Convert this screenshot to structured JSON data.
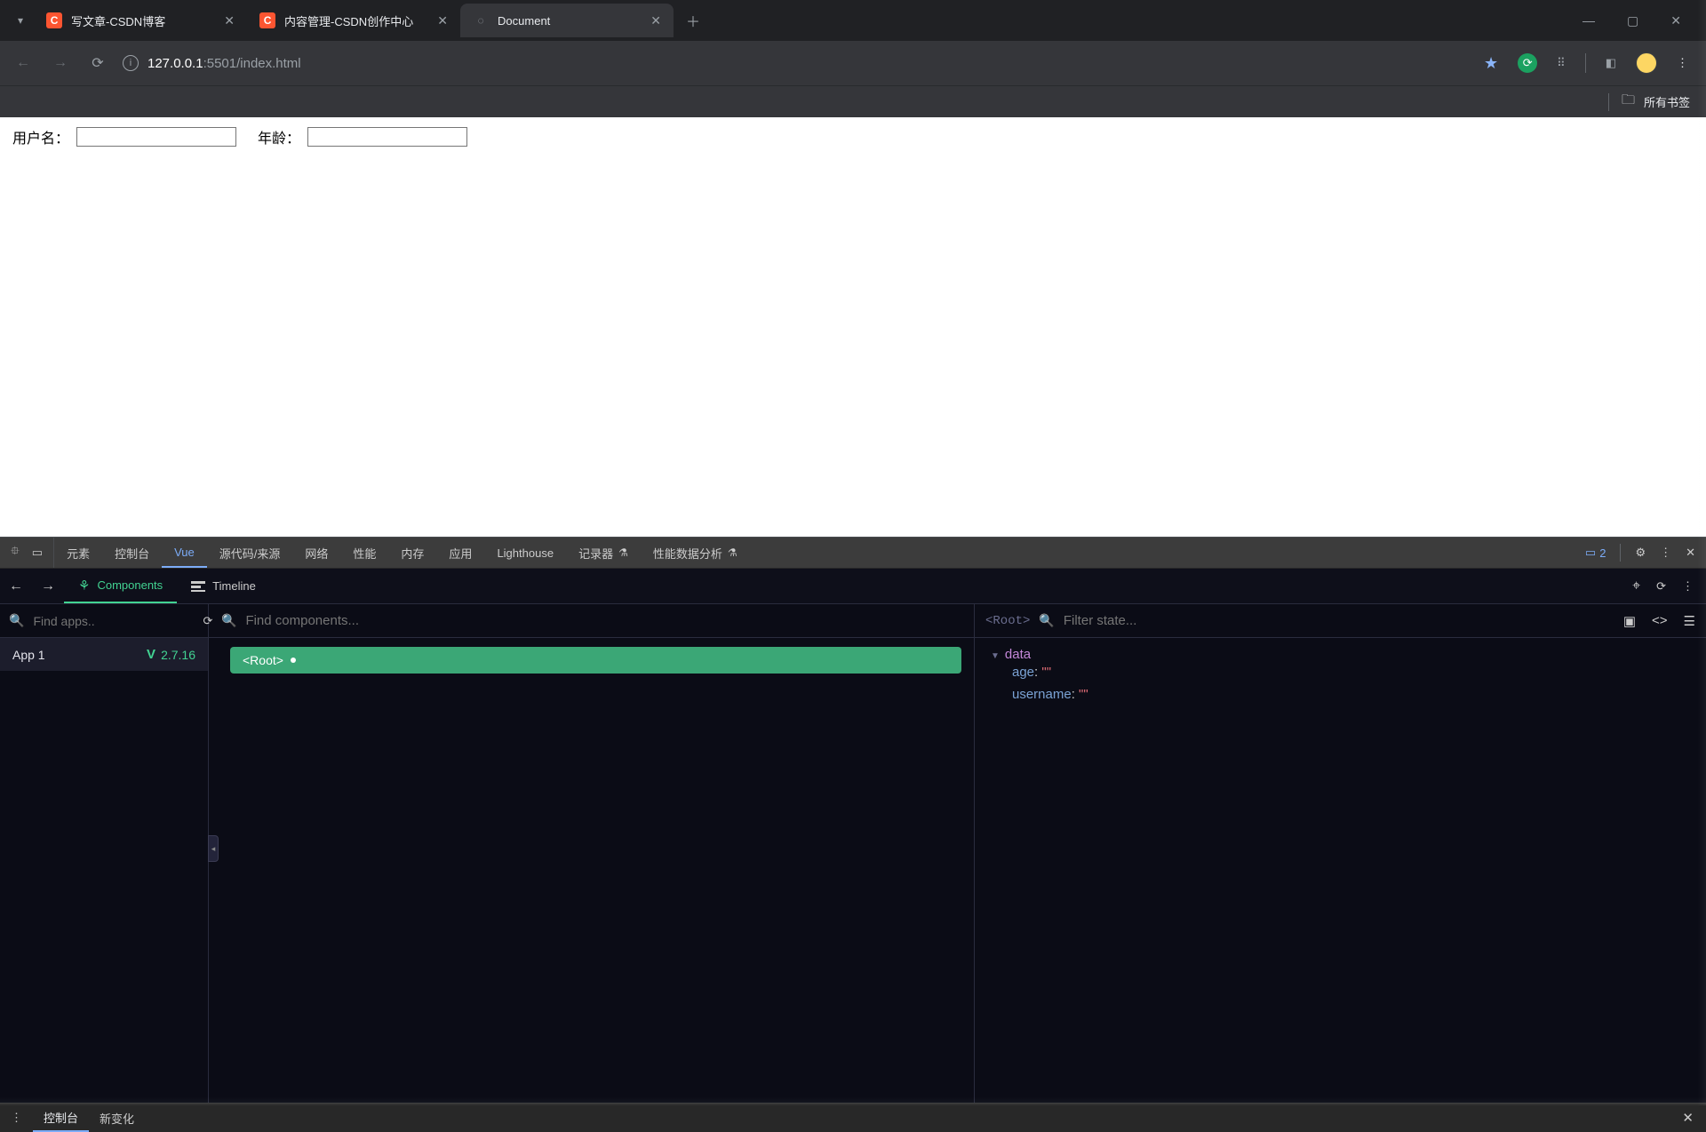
{
  "browser": {
    "tabs": [
      {
        "title": "写文章-CSDN博客",
        "favicon": "csdn",
        "active": false
      },
      {
        "title": "内容管理-CSDN创作中心",
        "favicon": "csdn",
        "active": false
      },
      {
        "title": "Document",
        "favicon": "globe",
        "active": true
      }
    ],
    "url": {
      "host": "127.0.0.1",
      "port_path": ":5501/index.html"
    },
    "bookmark_bar_label": "所有书签"
  },
  "page": {
    "label_username": "用户名：",
    "label_age": "年龄：",
    "value_username": "",
    "value_age": ""
  },
  "devtools": {
    "tabs": [
      "元素",
      "控制台",
      "Vue",
      "源代码/来源",
      "网络",
      "性能",
      "内存",
      "应用",
      "Lighthouse",
      "记录器",
      "性能数据分析"
    ],
    "active_tab": "Vue",
    "issues_count": "2"
  },
  "vue": {
    "tabs": {
      "components": "Components",
      "timeline": "Timeline"
    },
    "apps_search_placeholder": "Find apps..",
    "app_name": "App 1",
    "vue_version": "2.7.16",
    "components_search_placeholder": "Find components...",
    "selected_component": "<Root>",
    "state_root_label": "<Root>",
    "state_search_placeholder": "Filter state...",
    "state_section": "data",
    "state_props": [
      {
        "name": "age",
        "value": "\"\""
      },
      {
        "name": "username",
        "value": "\"\""
      }
    ]
  },
  "drawer": {
    "tabs": [
      "控制台",
      "新变化"
    ],
    "active": "控制台"
  }
}
